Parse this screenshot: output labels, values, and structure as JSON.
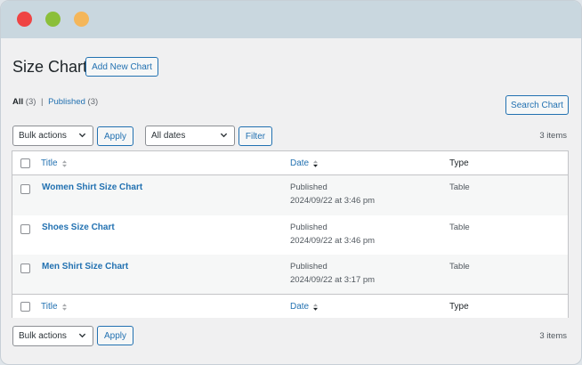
{
  "page": {
    "title": "Size Chart",
    "add_new_label": "Add New Chart",
    "search_label": "Search Chart"
  },
  "views": {
    "all_label": "All",
    "all_count": "(3)",
    "separator": "|",
    "published_label": "Published",
    "published_count": "(3)"
  },
  "actions": {
    "bulk_selected": "Bulk actions",
    "apply_label": "Apply",
    "dates_selected": "All dates",
    "filter_label": "Filter",
    "items_count": "3 items"
  },
  "table": {
    "columns": {
      "title": "Title",
      "date": "Date",
      "type": "Type"
    },
    "rows": [
      {
        "title": "Women Shirt Size Chart",
        "status": "Published",
        "datetime": "2024/09/22 at 3:46 pm",
        "type": "Table"
      },
      {
        "title": "Shoes Size Chart",
        "status": "Published",
        "datetime": "2024/09/22 at 3:46 pm",
        "type": "Table"
      },
      {
        "title": "Men Shirt Size Chart",
        "status": "Published",
        "datetime": "2024/09/22 at 3:17 pm",
        "type": "Table"
      }
    ]
  },
  "colors": {
    "accent": "#2271b1",
    "window_close": "#ef4444",
    "window_zoom": "#8bbf3a",
    "window_minimize": "#f4b65a"
  },
  "icons": {
    "sort": "sort-icon",
    "chevron": "chevron-down-icon"
  }
}
